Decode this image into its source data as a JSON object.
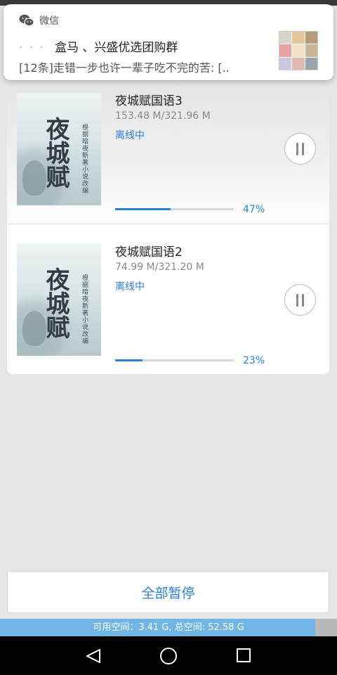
{
  "notification": {
    "app_name": "微信",
    "title_prefix": "·  ·  ·",
    "title": "盒马 、兴盛优选团购群",
    "text": "[12条]走错一步也许一辈子吃不完的苦: [..",
    "icon": "wechat-icon"
  },
  "downloads": [
    {
      "title": "夜城赋国语3",
      "size": "153.48 M/321.96 M",
      "status": "离线中",
      "progress": 0.47,
      "percent": "47%",
      "cover_title": "夜城赋",
      "cover_subtitle": "根据暗夜新著小说改编"
    },
    {
      "title": "夜城赋国语2",
      "size": "74.99 M/321.20 M",
      "status": "离线中",
      "progress": 0.23,
      "percent": "23%",
      "cover_title": "夜城赋",
      "cover_subtitle": "根据暗夜新著小说改编"
    }
  ],
  "pause_all_label": "全部暂停",
  "storage": {
    "text": "可用空间：3.41 G, 总空间: 52.58 G",
    "used_fraction": 0.935
  },
  "colors": {
    "accent": "#2b7fd4",
    "storage_fill": "#6fb5e6",
    "background": "#e6e6e6"
  }
}
